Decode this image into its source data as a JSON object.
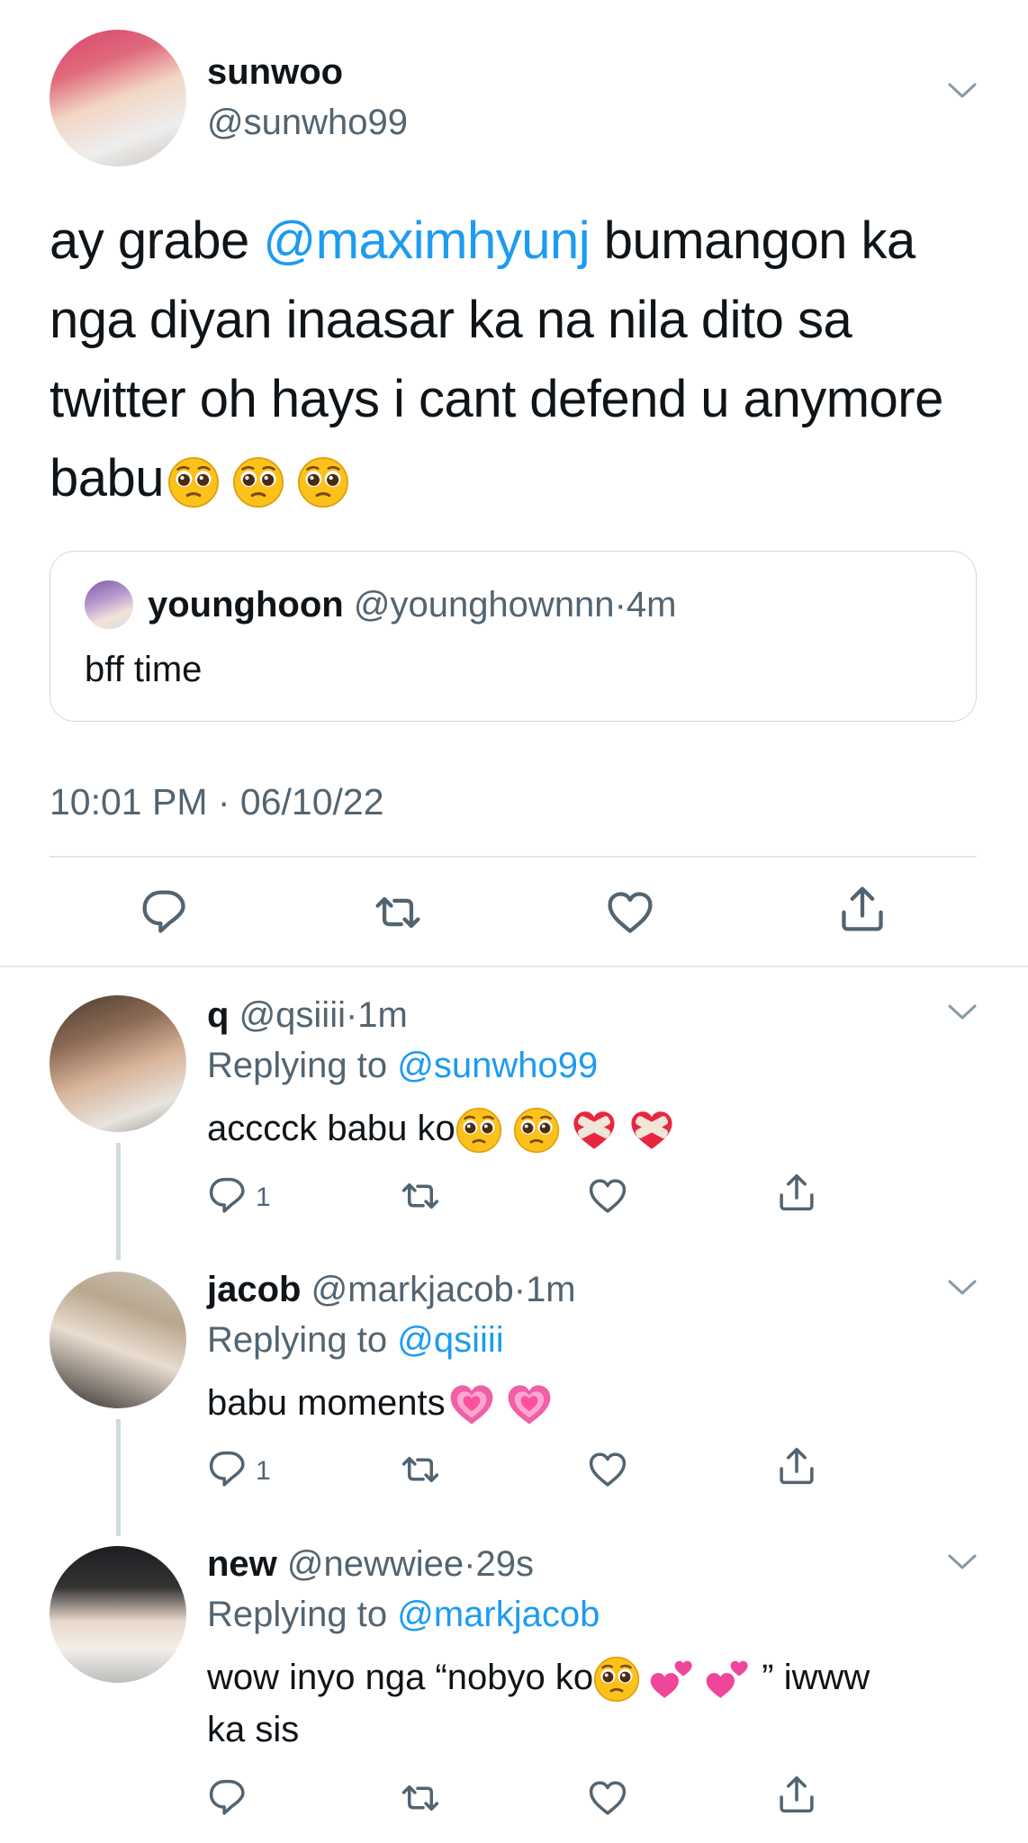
{
  "main_tweet": {
    "name": "sunwoo",
    "handle": "@sunwho99",
    "text_before": "ay grabe ",
    "mention": "@maximhyunj",
    "text_after": " bumangon ka nga diyan inaasar ka na nila dito sa twitter oh hays i cant defend u anymore babu",
    "emojis": [
      "pleading-face",
      "pleading-face",
      "pleading-face"
    ],
    "quote": {
      "name": "younghoon",
      "handle": "@younghownnn",
      "separator": "·",
      "time": "4m",
      "text": "bff time"
    },
    "timestamp": "10:01 PM · 06/10/22"
  },
  "replies": [
    {
      "name": "q",
      "handle": "@qsiiii",
      "separator": "·",
      "time": "1m",
      "replying_label": "Replying to ",
      "replying_to": "@sunwho99",
      "text": "acccck babu ko",
      "emojis": [
        "pleading-face",
        "pleading-face",
        "mending-heart",
        "mending-heart"
      ],
      "reply_count": "1"
    },
    {
      "name": "jacob",
      "handle": "@markjacob",
      "separator": "·",
      "time": "1m",
      "replying_label": "Replying to ",
      "replying_to": "@qsiiii",
      "text": "babu moments",
      "emojis": [
        "growing-heart",
        "growing-heart"
      ],
      "reply_count": "1"
    },
    {
      "name": "new",
      "handle": "@newwiee",
      "separator": "·",
      "time": "29s",
      "replying_label": "Replying to ",
      "replying_to": "@markjacob",
      "text_before": "wow inyo nga “nobyo ko",
      "text_after": " ” iwww",
      "text_line2": "ka sis",
      "emojis": [
        "pleading-face",
        "two-hearts",
        "two-hearts"
      ]
    }
  ],
  "colors": {
    "accent": "#1d9bf0",
    "secondary_text": "#536471",
    "divider": "#e1e8ed",
    "thread_line": "#cfd9de"
  }
}
